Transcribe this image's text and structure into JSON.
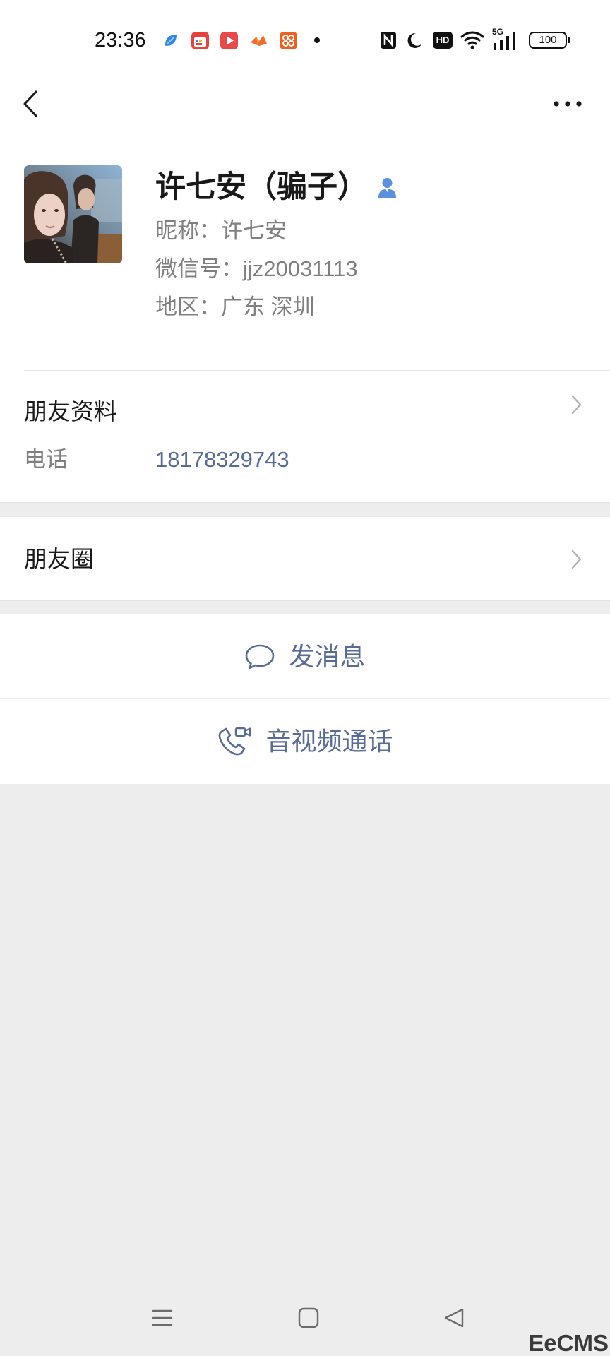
{
  "colors": {
    "accent": "#576b95",
    "text_primary": "#191919",
    "text_secondary": "#7f7f7f",
    "background": "#ededed",
    "surface": "#ffffff",
    "contact_icon": "#5b8fe0"
  },
  "status_bar": {
    "time": "23:36",
    "hd_label": "HD",
    "network_label": "5G",
    "battery_level": "100",
    "icons": [
      "blue-app-icon",
      "calendar-app-icon",
      "video-app-icon",
      "orange-app-icon",
      "orange-grid-app-icon",
      "notification-dot-icon",
      "nfc-icon",
      "moon-icon",
      "hd-icon",
      "wifi-icon",
      "signal-icon",
      "battery-icon"
    ]
  },
  "nav": {
    "icons": [
      "chevron-left-icon",
      "more-icon"
    ]
  },
  "profile": {
    "name": "许七安（骗子）",
    "contact_icon": "person-icon",
    "nickname_label": "昵称：",
    "nickname": "许七安",
    "wechat_id_label": "微信号：",
    "wechat_id": "jjz20031113",
    "region_label": "地区：",
    "region": "广东 深圳"
  },
  "friend_info": {
    "title": "朋友资料",
    "phone_label": "电话",
    "phone": "18178329743"
  },
  "moments": {
    "title": "朋友圈"
  },
  "actions": [
    {
      "label": "发消息",
      "icon": "chat-bubble-icon"
    },
    {
      "label": "音视频通话",
      "icon": "video-call-icon"
    }
  ],
  "bottom_nav": {
    "icons": [
      "menu-icon",
      "home-icon",
      "back-icon"
    ]
  },
  "watermark": "EeCMS"
}
